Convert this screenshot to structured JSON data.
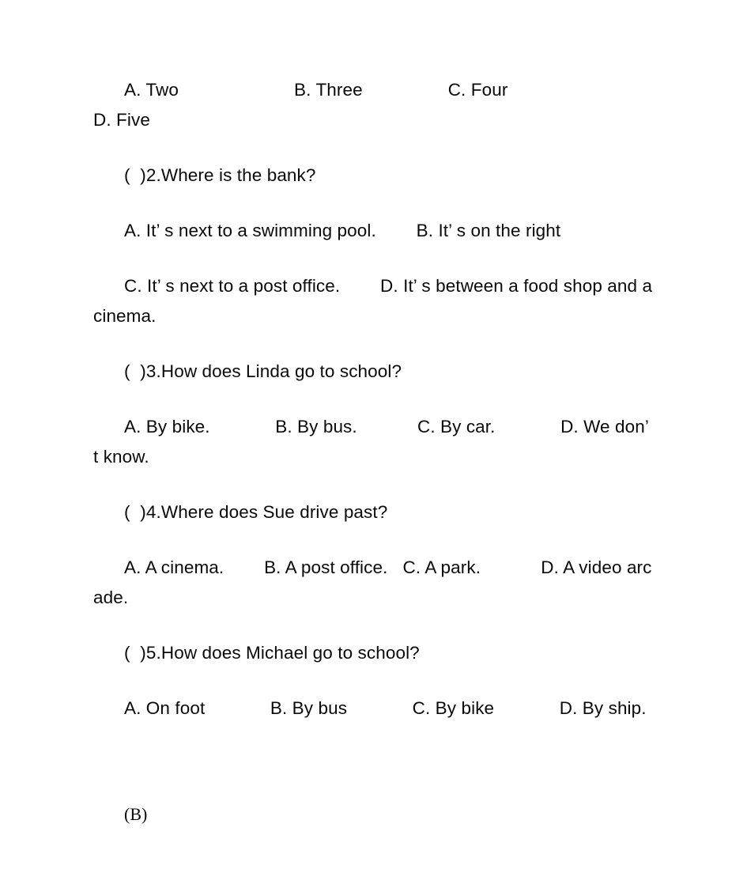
{
  "document": {
    "background_color": "#ffffff",
    "text_color": "#0a0a0a",
    "paragraphs": [
      {
        "id": "q1-options",
        "kind": "options",
        "text": "A. Two                       B. Three                 C. Four                            D. Five"
      },
      {
        "id": "q2-stem",
        "kind": "question",
        "number": "2",
        "text": "(  )2.Where is the bank?"
      },
      {
        "id": "q2-options-ab",
        "kind": "options",
        "text": "A. It’ s next to a swimming pool.        B. It’ s on the right"
      },
      {
        "id": "q2-options-cd",
        "kind": "options",
        "text": "C. It’ s next to a post office.        D. It’ s between a food shop and a cinema."
      },
      {
        "id": "q3-stem",
        "kind": "question",
        "number": "3",
        "text": "(  )3.How does Linda go to school?"
      },
      {
        "id": "q3-options",
        "kind": "options",
        "text": "A. By bike.             B. By bus.            C. By car.             D. We don’ t know."
      },
      {
        "id": "q4-stem",
        "kind": "question",
        "number": "4",
        "text": "(  )4.Where does Sue drive past?"
      },
      {
        "id": "q4-options",
        "kind": "options",
        "text": "A. A cinema.        B. A post office.   C. A park.            D. A video arcade."
      },
      {
        "id": "q5-stem",
        "kind": "question",
        "number": "5",
        "text": "(  )5.How does Michael go to school?"
      },
      {
        "id": "q5-options",
        "kind": "options",
        "text": "A. On foot             B. By bus             C. By bike             D. By ship."
      }
    ],
    "section_marker": "(B)"
  }
}
